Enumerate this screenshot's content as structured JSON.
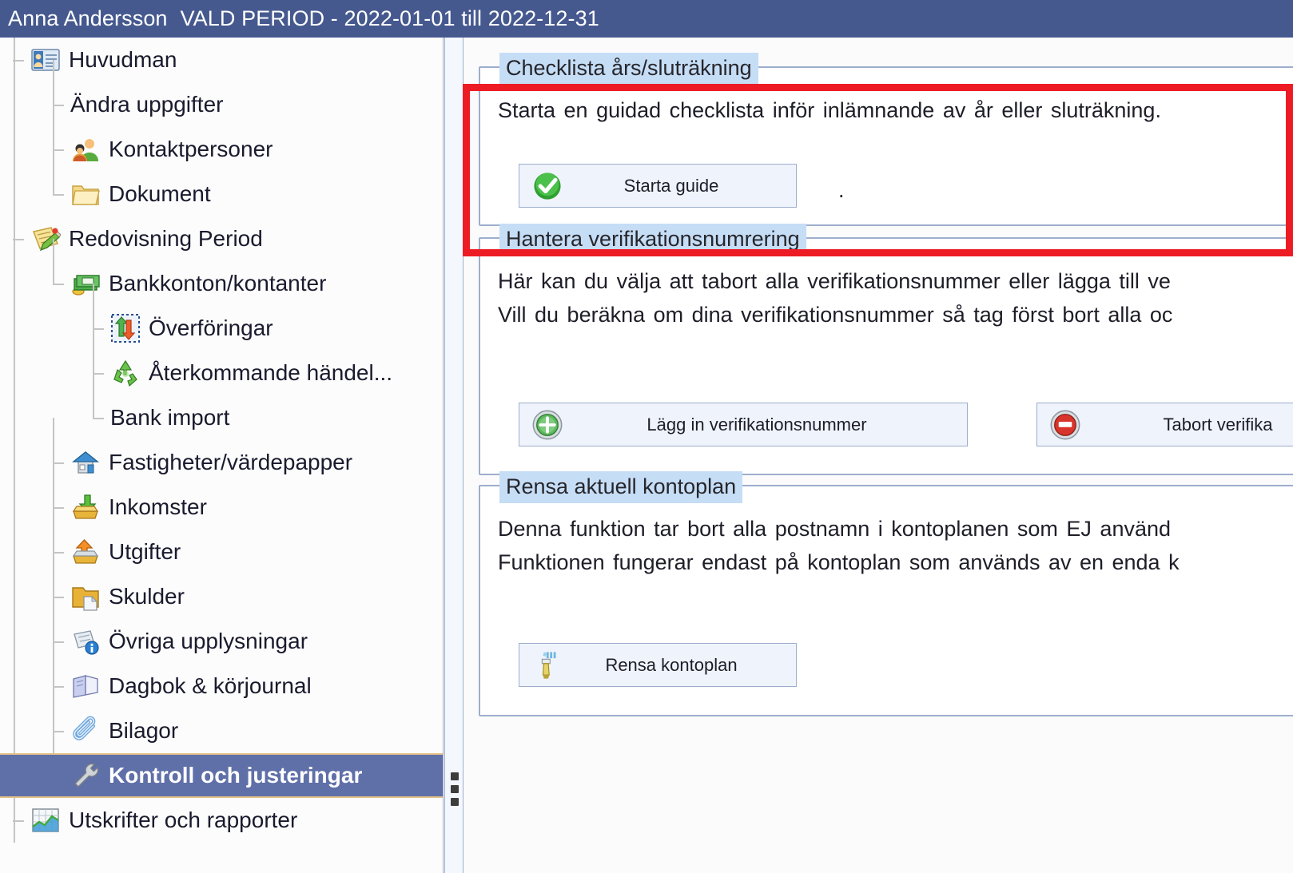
{
  "titlebar": {
    "client_name": "Anna Andersson",
    "period_label": "VALD PERIOD - 2022-01-01 till 2022-12-31"
  },
  "sidebar": {
    "items": [
      {
        "label": "Huvudman",
        "icon": "contact-card-icon",
        "level": 1,
        "selected": false
      },
      {
        "label": "Ändra uppgifter",
        "icon": "none",
        "level": 2,
        "selected": false
      },
      {
        "label": "Kontaktpersoner",
        "icon": "people-icon",
        "level": 2,
        "selected": false
      },
      {
        "label": "Dokument",
        "icon": "folder-icon",
        "level": 2,
        "selected": false
      },
      {
        "label": "Redovisning Period",
        "icon": "notepad-pencil-icon",
        "level": 1,
        "selected": false
      },
      {
        "label": "Bankkonton/kontanter",
        "icon": "money-icon",
        "level": 2,
        "selected": false
      },
      {
        "label": "Överföringar",
        "icon": "transfer-icon",
        "level": 3,
        "selected": false
      },
      {
        "label": "Återkommande  händel...",
        "icon": "recycle-icon",
        "level": 3,
        "selected": false
      },
      {
        "label": "Bank import",
        "icon": "none",
        "level": 3,
        "selected": false
      },
      {
        "label": "Fastigheter/värdepapper",
        "icon": "house-icon",
        "level": 2,
        "selected": false
      },
      {
        "label": "Inkomster",
        "icon": "inbox-down-icon",
        "level": 2,
        "selected": false
      },
      {
        "label": "Utgifter",
        "icon": "outbox-up-icon",
        "level": 2,
        "selected": false
      },
      {
        "label": "Skulder",
        "icon": "debt-folder-icon",
        "level": 2,
        "selected": false
      },
      {
        "label": "Övriga upplysningar",
        "icon": "info-note-icon",
        "level": 2,
        "selected": false
      },
      {
        "label": "Dagbok & körjournal",
        "icon": "book-icon",
        "level": 2,
        "selected": false
      },
      {
        "label": "Bilagor",
        "icon": "paperclip-icon",
        "level": 2,
        "selected": false
      },
      {
        "label": "Kontroll och justeringar",
        "icon": "wrench-icon",
        "level": 2,
        "selected": true
      },
      {
        "label": "Utskrifter och rapporter",
        "icon": "chart-report-icon",
        "level": 1,
        "selected": false
      }
    ]
  },
  "splitter": {
    "grip_icon": "splitter-grip-icon"
  },
  "main": {
    "groups": [
      {
        "title": "Checklista års/sluträkning",
        "lines": [
          "Starta en guidad  checklista  inför  inlämnande  av  år  eller  sluträkning."
        ],
        "trailing_text": ".",
        "buttons": [
          {
            "label": "Starta guide",
            "icon": "green-check-icon"
          }
        ],
        "highlighted": true
      },
      {
        "title": "Hantera verifikationsnumrering",
        "lines": [
          "Här  kan  du  välja  att  tabort  alla  verifikationsnummer  eller  lägga  till  ve",
          "Vill  du  beräkna  om  dina  verifikationsnummer  så  tag  först  bort  alla  oc"
        ],
        "buttons": [
          {
            "label": "Lägg in verifikationsnummer",
            "icon": "green-plus-icon"
          },
          {
            "label": "Tabort verifika",
            "icon": "red-minus-icon"
          }
        ],
        "highlighted": false
      },
      {
        "title": "Rensa aktuell kontoplan",
        "lines": [
          "Denna  funktion  tar  bort  alla  postnamn  i  kontoplanen  som  EJ  använd",
          "Funktionen  fungerar  endast  på  kontoplan  som  används  av  en  enda  k"
        ],
        "buttons": [
          {
            "label": "Rensa kontoplan",
            "icon": "cleaning-brush-icon"
          }
        ],
        "highlighted": false
      }
    ]
  },
  "colors": {
    "titlebar_bg": "#46598f",
    "selection_bg": "#5f6fa8",
    "selection_border": "#e4c188",
    "group_title_bg": "#c6ddf6",
    "panel_border": "#9daecd",
    "highlight_red": "#ed1c24",
    "button_bg": "#eff3fc"
  }
}
